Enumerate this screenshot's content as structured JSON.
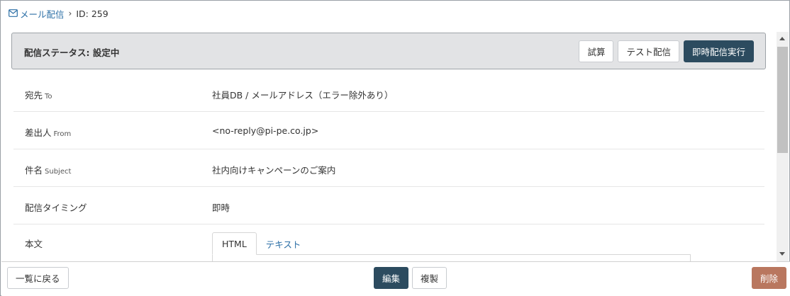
{
  "breadcrumb": {
    "parent_icon": "mail-icon",
    "parent_label": "メール配信",
    "separator": "›",
    "current_label": "ID: 259"
  },
  "status_bar": {
    "title": "配信ステータス: 設定中",
    "buttons": {
      "trial": "試算",
      "test_send": "テスト配信",
      "send_now": "即時配信実行"
    }
  },
  "rows": [
    {
      "label": "宛先",
      "label_en": "To",
      "value": "社員DB / メールアドレス（エラー除外あり）"
    },
    {
      "label": "差出人",
      "label_en": "From",
      "value": "<no-reply@pi-pe.co.jp>"
    },
    {
      "label": "件名",
      "label_en": "Subject",
      "value": "社内向けキャンペーンのご案内"
    },
    {
      "label": "配信タイミング",
      "label_en": "",
      "value": "即時"
    },
    {
      "label": "本文",
      "label_en": "",
      "value": ""
    }
  ],
  "body_tabs": [
    {
      "label": "HTML",
      "active": true
    },
    {
      "label": "テキスト",
      "active": false
    }
  ],
  "footer": {
    "back": "一覧に戻る",
    "edit": "編集",
    "copy": "複製",
    "delete": "削除"
  },
  "colors": {
    "primary": "#2c4b5f",
    "danger": "#b9775f",
    "link": "#2c6fa6",
    "status_bg": "#e2e3e5"
  }
}
